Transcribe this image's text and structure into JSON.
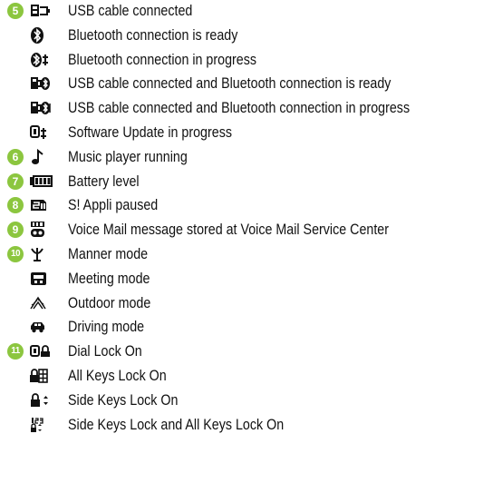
{
  "colors": {
    "badge": "#8cc63f",
    "text": "#111111",
    "icon": "#111111"
  },
  "rows": [
    {
      "number": "5",
      "icon": "usb-cable-icon",
      "label": "USB cable connected"
    },
    {
      "number": "",
      "icon": "bluetooth-ready-icon",
      "label": "Bluetooth connection is ready"
    },
    {
      "number": "",
      "icon": "bluetooth-progress-icon",
      "label": "Bluetooth connection in progress"
    },
    {
      "number": "",
      "icon": "usb-bluetooth-ready-icon",
      "label": "USB cable connected and Bluetooth connection is ready"
    },
    {
      "number": "",
      "icon": "usb-bluetooth-progress-icon",
      "label": "USB cable connected and Bluetooth connection in progress"
    },
    {
      "number": "",
      "icon": "software-update-icon",
      "label": "Software Update in progress"
    },
    {
      "number": "6",
      "icon": "music-note-icon",
      "label": "Music player running"
    },
    {
      "number": "7",
      "icon": "battery-icon",
      "label": "Battery level"
    },
    {
      "number": "8",
      "icon": "sappli-paused-icon",
      "label": "S! Appli paused"
    },
    {
      "number": "9",
      "icon": "voice-mail-icon",
      "label": "Voice Mail message stored at Voice Mail Service Center"
    },
    {
      "number": "10",
      "icon": "manner-mode-icon",
      "label": "Manner mode"
    },
    {
      "number": "",
      "icon": "meeting-mode-icon",
      "label": "Meeting mode"
    },
    {
      "number": "",
      "icon": "outdoor-mode-icon",
      "label": "Outdoor mode"
    },
    {
      "number": "",
      "icon": "driving-mode-icon",
      "label": "Driving mode"
    },
    {
      "number": "11",
      "icon": "dial-lock-icon",
      "label": "Dial Lock On"
    },
    {
      "number": "",
      "icon": "all-keys-lock-icon",
      "label": "All Keys Lock On"
    },
    {
      "number": "",
      "icon": "side-keys-lock-icon",
      "label": "Side Keys Lock On"
    },
    {
      "number": "",
      "icon": "side-and-all-keys-lock-icon",
      "label": "Side Keys Lock and All Keys Lock On"
    }
  ]
}
